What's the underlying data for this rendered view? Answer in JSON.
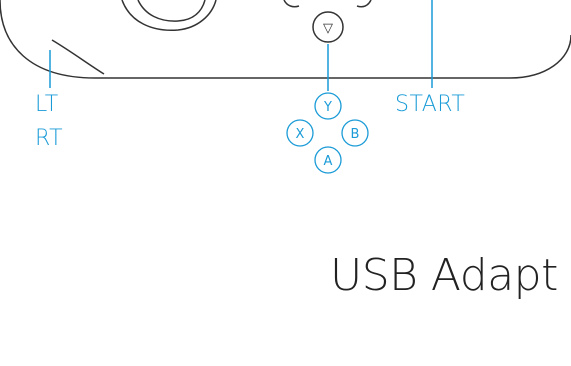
{
  "colors": {
    "accent": "#1a9bd7",
    "outline": "#333333",
    "heading": "#222222"
  },
  "labels": {
    "lt": "LT",
    "rt": "RT",
    "start": "START"
  },
  "face_buttons": {
    "y": "Y",
    "x": "X",
    "b": "B",
    "a": "A"
  },
  "dpad_down_glyph": "▽",
  "heading": "USB Adapt"
}
